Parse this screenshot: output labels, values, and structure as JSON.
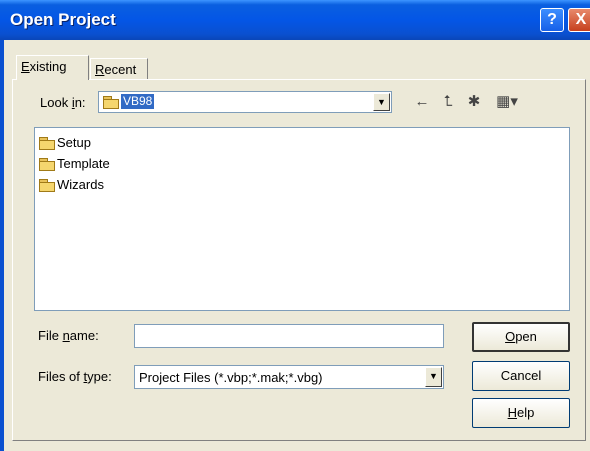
{
  "window": {
    "title": "Open Project"
  },
  "titlebar": {
    "help_label": "?",
    "close_label": "X"
  },
  "tabs": [
    {
      "label_prefix": "E",
      "label_rest": "xisting"
    },
    {
      "label_prefix": "R",
      "label_rest": "ecent"
    }
  ],
  "look_in": {
    "label_before": "Look ",
    "label_accel": "i",
    "label_after": "n:",
    "value": "VB98"
  },
  "toolbar": {
    "back_icon": "←",
    "up_icon": "⮤",
    "new_folder_icon": "✱",
    "view_menu_icon": "▦▾"
  },
  "files": [
    {
      "name": "Setup",
      "icon": "folder-icon"
    },
    {
      "name": "Template",
      "icon": "folder-icon"
    },
    {
      "name": "Wizards",
      "icon": "folder-icon"
    }
  ],
  "file_name": {
    "label_before": "File ",
    "label_accel": "n",
    "label_after": "ame:",
    "value": ""
  },
  "file_type": {
    "label_before": "Files of ",
    "label_accel": "t",
    "label_after": "ype:",
    "value": "Project Files (*.vbp;*.mak;*.vbg)"
  },
  "buttons": {
    "open_accel": "O",
    "open_rest": "pen",
    "cancel": "Cancel",
    "help_accel": "H",
    "help_rest": "elp"
  }
}
